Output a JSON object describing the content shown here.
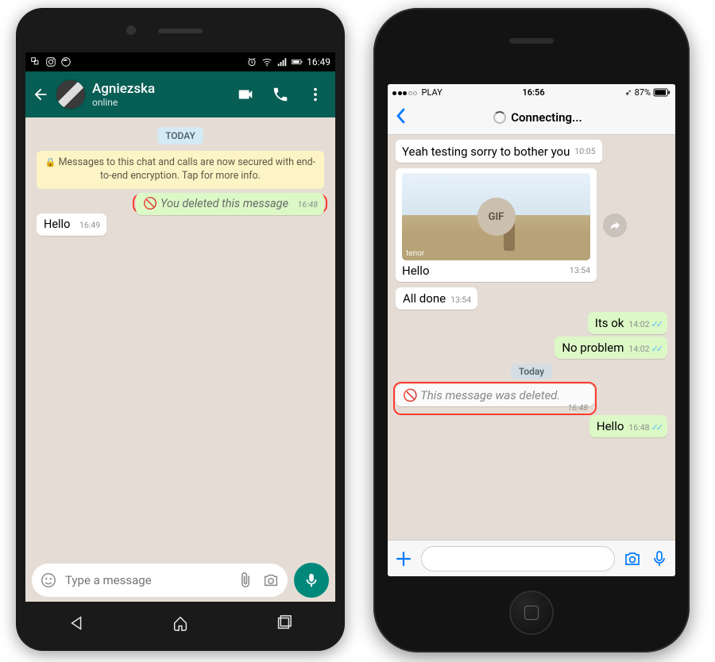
{
  "android": {
    "status": {
      "time": "16:49"
    },
    "header": {
      "name": "Agniezska",
      "presence": "online"
    },
    "chat": {
      "date": "TODAY",
      "encryption": "Messages to this chat and calls are now secured with end-to-end encryption. Tap for more info.",
      "deleted_msg": "You deleted this message",
      "deleted_time": "16:48",
      "hello": "Hello",
      "hello_time": "16:49"
    },
    "input": {
      "placeholder": "Type a message"
    }
  },
  "iphone": {
    "status": {
      "carrier": "PLAY",
      "time": "16:56",
      "battery": "87%"
    },
    "header": {
      "connecting": "Connecting..."
    },
    "chat": {
      "m1": "Yeah testing sorry to bother you",
      "m1_time": "10:05",
      "gif_label": "GIF",
      "tenor": "tenor",
      "hello1": "Hello",
      "hello1_time": "13:54",
      "alldone": "All done",
      "alldone_time": "13:54",
      "itsok": "Its ok",
      "itsok_time": "14:02",
      "noproblem": "No problem",
      "noproblem_time": "14:02",
      "date": "Today",
      "deleted": "This message was deleted.",
      "deleted_time": "16:48",
      "hello2": "Hello",
      "hello2_time": "16:48"
    }
  }
}
